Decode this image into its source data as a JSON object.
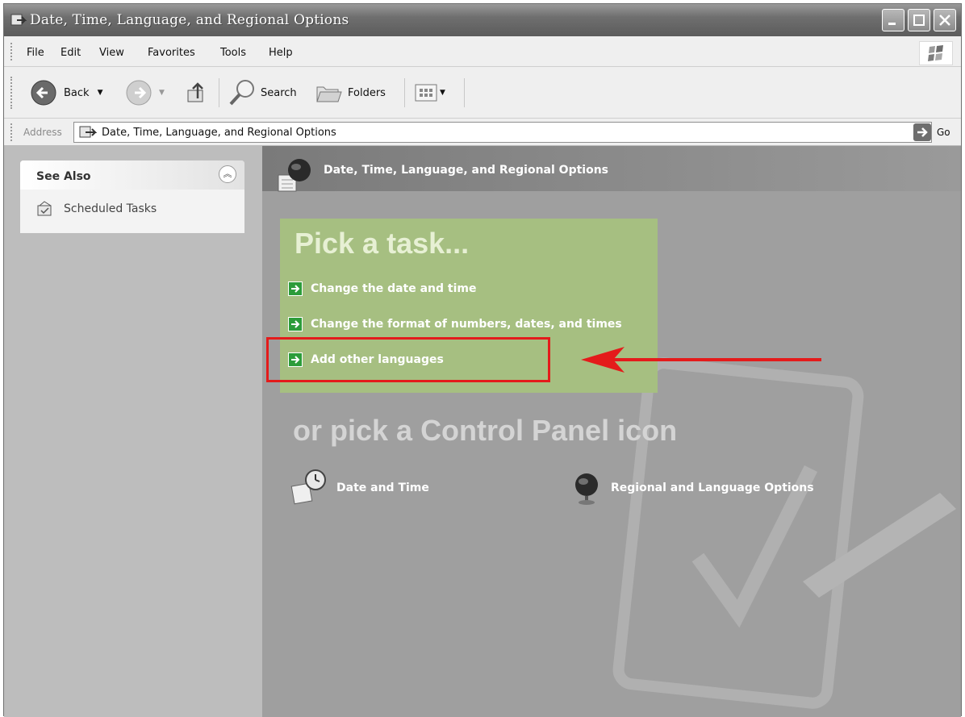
{
  "window": {
    "title": "Date, Time, Language, and Regional Options"
  },
  "menu": {
    "items": [
      "File",
      "Edit",
      "View",
      "Favorites",
      "Tools",
      "Help"
    ]
  },
  "toolbar": {
    "back": "Back",
    "search": "Search",
    "folders": "Folders"
  },
  "address": {
    "label": "Address",
    "value": "Date, Time, Language, and Regional Options",
    "go": "Go"
  },
  "see_also": {
    "title": "See Also",
    "items": [
      "Scheduled Tasks"
    ]
  },
  "main": {
    "header": "Date, Time, Language, and Regional Options",
    "pick_task_title": "Pick a task...",
    "tasks": [
      "Change the date and time",
      "Change the format of numbers, dates, and times",
      "Add other languages"
    ],
    "or_pick_title": "or pick a Control Panel icon",
    "icons": [
      "Date and Time",
      "Regional and Language Options"
    ]
  },
  "colors": {
    "highlight": "#e41b1b",
    "task_pane": "#a6bf81",
    "arrow_green": "#2c9c3a"
  }
}
